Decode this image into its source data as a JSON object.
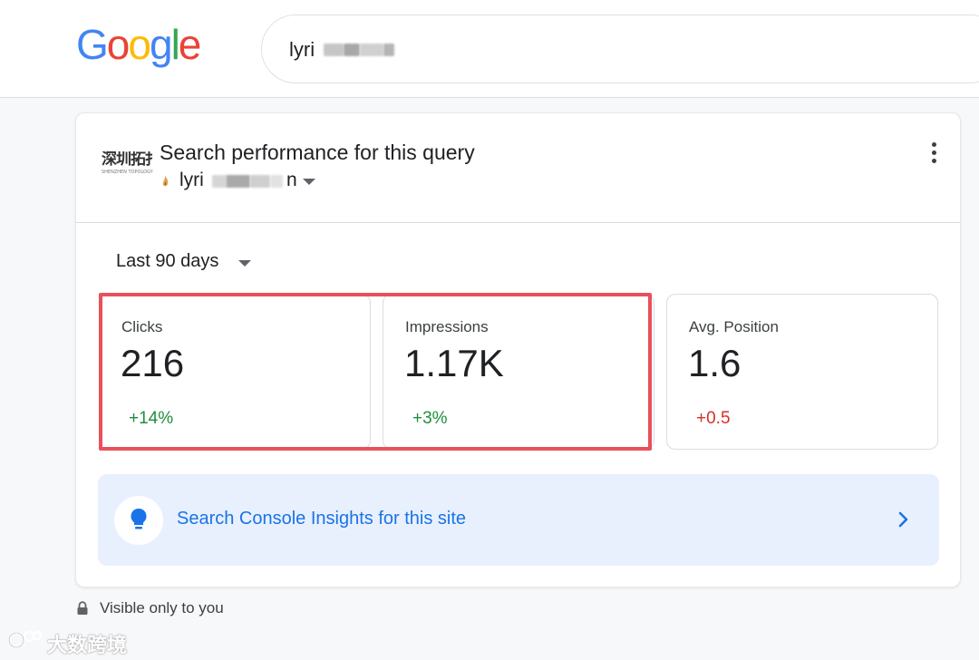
{
  "logo": {
    "letters": [
      "G",
      "o",
      "o",
      "g",
      "l",
      "e"
    ]
  },
  "search": {
    "query": "lyri"
  },
  "card": {
    "site_logo_text": "深圳拓扑",
    "site_logo_subtext": "SHENZHEN TOPOLOGY",
    "title": "Search performance for this query",
    "query_prefix": "lyri",
    "query_suffix": "n",
    "date_range": "Last 90 days",
    "metrics": [
      {
        "label": "Clicks",
        "value": "216",
        "delta": "+14%"
      },
      {
        "label": "Impressions",
        "value": "1.17K",
        "delta": "+3%"
      },
      {
        "label": "Avg. Position",
        "value": "1.6",
        "delta": "+0.5"
      }
    ],
    "insights_label": "Search Console Insights for this site"
  },
  "footer": {
    "visibility_note": "Visible only to you"
  },
  "watermark": {
    "text": "大数跨境"
  },
  "colors": {
    "positive": "#1e8e3e",
    "negative": "#d93025",
    "link": "#1a73e8",
    "highlight": "#e8505b",
    "insights_bg": "#e8f0fe"
  },
  "icons": [
    "flame-icon",
    "dropdown-caret-icon",
    "more-vert-icon",
    "lightbulb-icon",
    "chevron-right-icon",
    "lock-icon"
  ]
}
